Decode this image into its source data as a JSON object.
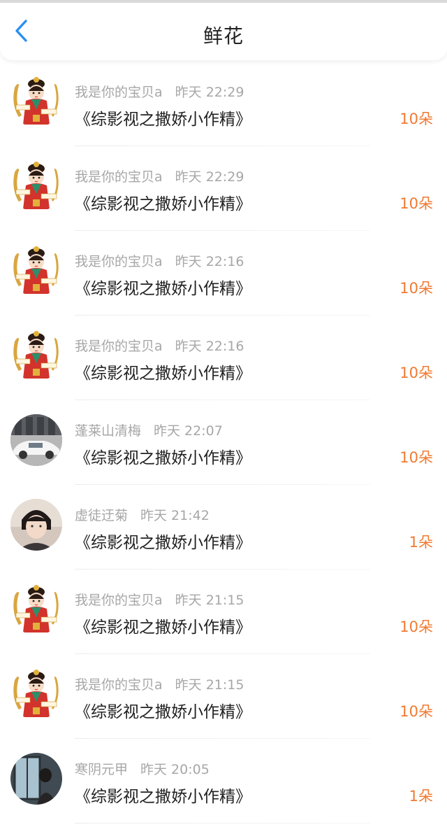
{
  "header": {
    "title": "鲜花"
  },
  "colors": {
    "accent_blue": "#2b8ff2",
    "amount_orange": "#f07a32",
    "meta_gray": "#a7a7a7",
    "text_dark": "#222222"
  },
  "items": [
    {
      "user": "我是你的宝贝a",
      "time": "昨天 22:29",
      "book": "《综影视之撒娇小作精》",
      "amount": "10朵",
      "avatar": "goddess-avatar"
    },
    {
      "user": "我是你的宝贝a",
      "time": "昨天 22:29",
      "book": "《综影视之撒娇小作精》",
      "amount": "10朵",
      "avatar": "goddess-avatar"
    },
    {
      "user": "我是你的宝贝a",
      "time": "昨天 22:16",
      "book": "《综影视之撒娇小作精》",
      "amount": "10朵",
      "avatar": "goddess-avatar"
    },
    {
      "user": "我是你的宝贝a",
      "time": "昨天 22:16",
      "book": "《综影视之撒娇小作精》",
      "amount": "10朵",
      "avatar": "goddess-avatar"
    },
    {
      "user": "蓬莱山清梅",
      "time": "昨天 22:07",
      "book": "《综影视之撒娇小作精》",
      "amount": "10朵",
      "avatar": "car-photo-avatar"
    },
    {
      "user": "虚徒迂菊",
      "time": "昨天 21:42",
      "book": "《综影视之撒娇小作精》",
      "amount": "1朵",
      "avatar": "portrait-photo-avatar"
    },
    {
      "user": "我是你的宝贝a",
      "time": "昨天 21:15",
      "book": "《综影视之撒娇小作精》",
      "amount": "10朵",
      "avatar": "goddess-avatar"
    },
    {
      "user": "我是你的宝贝a",
      "time": "昨天 21:15",
      "book": "《综影视之撒娇小作精》",
      "amount": "10朵",
      "avatar": "goddess-avatar"
    },
    {
      "user": "寒阴元甲",
      "time": "昨天 20:05",
      "book": "《综影视之撒娇小作精》",
      "amount": "1朵",
      "avatar": "window-photo-avatar"
    }
  ]
}
